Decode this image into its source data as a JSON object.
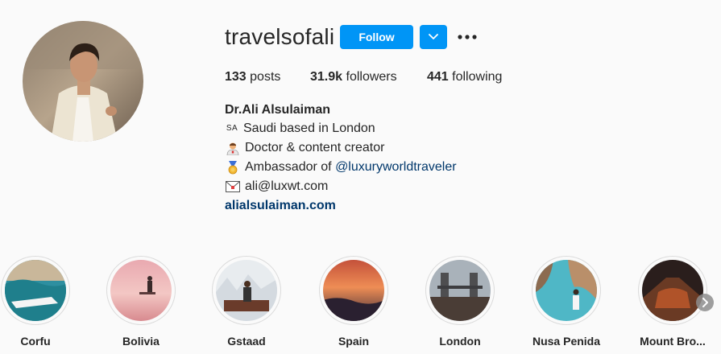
{
  "profile": {
    "username": "travelsofali",
    "follow_label": "Follow",
    "stats": {
      "posts_count": "133",
      "posts_label": "posts",
      "followers_count": "31.9k",
      "followers_label": "followers",
      "following_count": "441",
      "following_label": "following"
    },
    "bio": {
      "name": "Dr.Ali Alsulaiman",
      "flag_text": "SA",
      "line1": "Saudi based in London",
      "line2": "Doctor & content creator",
      "line3_prefix": "Ambassador of ",
      "line3_mention": "@luxuryworldtraveler",
      "line4": "ali@luxwt.com",
      "website": "alialsulaiman.com"
    }
  },
  "stories": [
    {
      "label": "Corfu"
    },
    {
      "label": "Bolivia"
    },
    {
      "label": "Gstaad"
    },
    {
      "label": "Spain"
    },
    {
      "label": "London"
    },
    {
      "label": "Nusa Penida"
    },
    {
      "label": "Mount Bro..."
    }
  ],
  "colors": {
    "accent": "#0095f6",
    "link": "#00376b",
    "text": "#262626",
    "background": "#fafafa"
  },
  "icons": {
    "dropdown": "chevron-down-icon",
    "more": "more-options-icon",
    "next": "chevron-right-icon"
  }
}
